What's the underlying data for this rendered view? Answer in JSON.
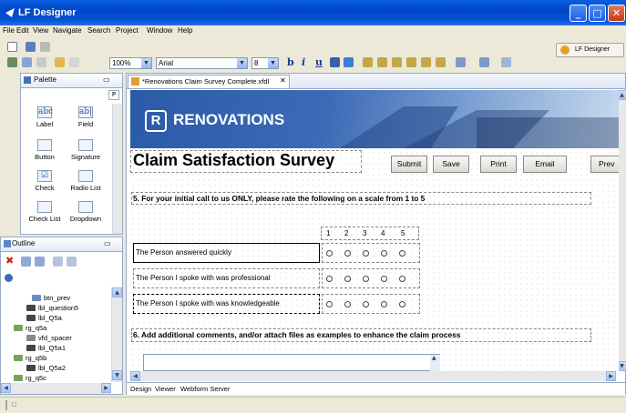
{
  "window": {
    "title": "LF Designer",
    "controls": [
      "minimize",
      "maximize",
      "close"
    ]
  },
  "menu": [
    "File",
    "Edit",
    "View",
    "Navigate",
    "Search",
    "Project",
    "Window",
    "Help"
  ],
  "toolbar": {
    "zoom": "100%",
    "font": "Arial",
    "size": "8",
    "format_buttons": [
      "b",
      "i",
      "u"
    ],
    "perspective": "LF Designer"
  },
  "palette": {
    "title": "Palette",
    "items": [
      {
        "label": "Label",
        "icon": "label-icon",
        "glyph": "abc"
      },
      {
        "label": "Field",
        "icon": "field-icon",
        "glyph": "ab|"
      },
      {
        "label": "Button",
        "icon": "button-icon",
        "glyph": ""
      },
      {
        "label": "Signature",
        "icon": "signature-icon",
        "glyph": ""
      },
      {
        "label": "Check",
        "icon": "check-icon",
        "glyph": "☑"
      },
      {
        "label": "Radio List",
        "icon": "radio-list-icon",
        "glyph": ""
      },
      {
        "label": "Check List",
        "icon": "check-list-icon",
        "glyph": ""
      },
      {
        "label": "Dropdown",
        "icon": "dropdown-icon",
        "glyph": ""
      }
    ]
  },
  "outline": {
    "title": "Outline",
    "items": [
      {
        "label": "btn_prev",
        "type": "button"
      },
      {
        "label": "lbl_question5",
        "type": "label"
      },
      {
        "label": "lbl_Q5a",
        "type": "label"
      },
      {
        "label": "rg_q5a",
        "type": "radio"
      },
      {
        "label": "vfd_spacer",
        "type": "spacer"
      },
      {
        "label": "lbl_Q5a1",
        "type": "label"
      },
      {
        "label": "rg_q5b",
        "type": "radio"
      },
      {
        "label": "lbl_Q5a2",
        "type": "label"
      },
      {
        "label": "rg_q5c",
        "type": "radio"
      }
    ]
  },
  "editor": {
    "tab": "*Renovations Claim Survey Complete.xfdl",
    "bottom_tabs": [
      "Design",
      "Viewer",
      "Webform Server"
    ]
  },
  "form": {
    "banner": "RENOVATIONS",
    "title": "Claim Satisfaction Survey",
    "buttons": [
      "Submit",
      "Save",
      "Print",
      "Email",
      "Prev"
    ],
    "q5": "5.  For your initial call to us ONLY, please rate the following on a scale from 1 to 5",
    "scale": [
      "1",
      "2",
      "3",
      "4",
      "5"
    ],
    "rows": [
      "The Person answered quickly",
      "The Person I spoke with was professional",
      "The Person I spoke with was knowledgeable"
    ],
    "q6": "6.  Add additional comments, and/or attach files as examples to enhance the claim process"
  },
  "colors": {
    "titlebar": "#0a5fe0",
    "banner": "#1c4a96",
    "panel_border": "#96a9c5"
  }
}
